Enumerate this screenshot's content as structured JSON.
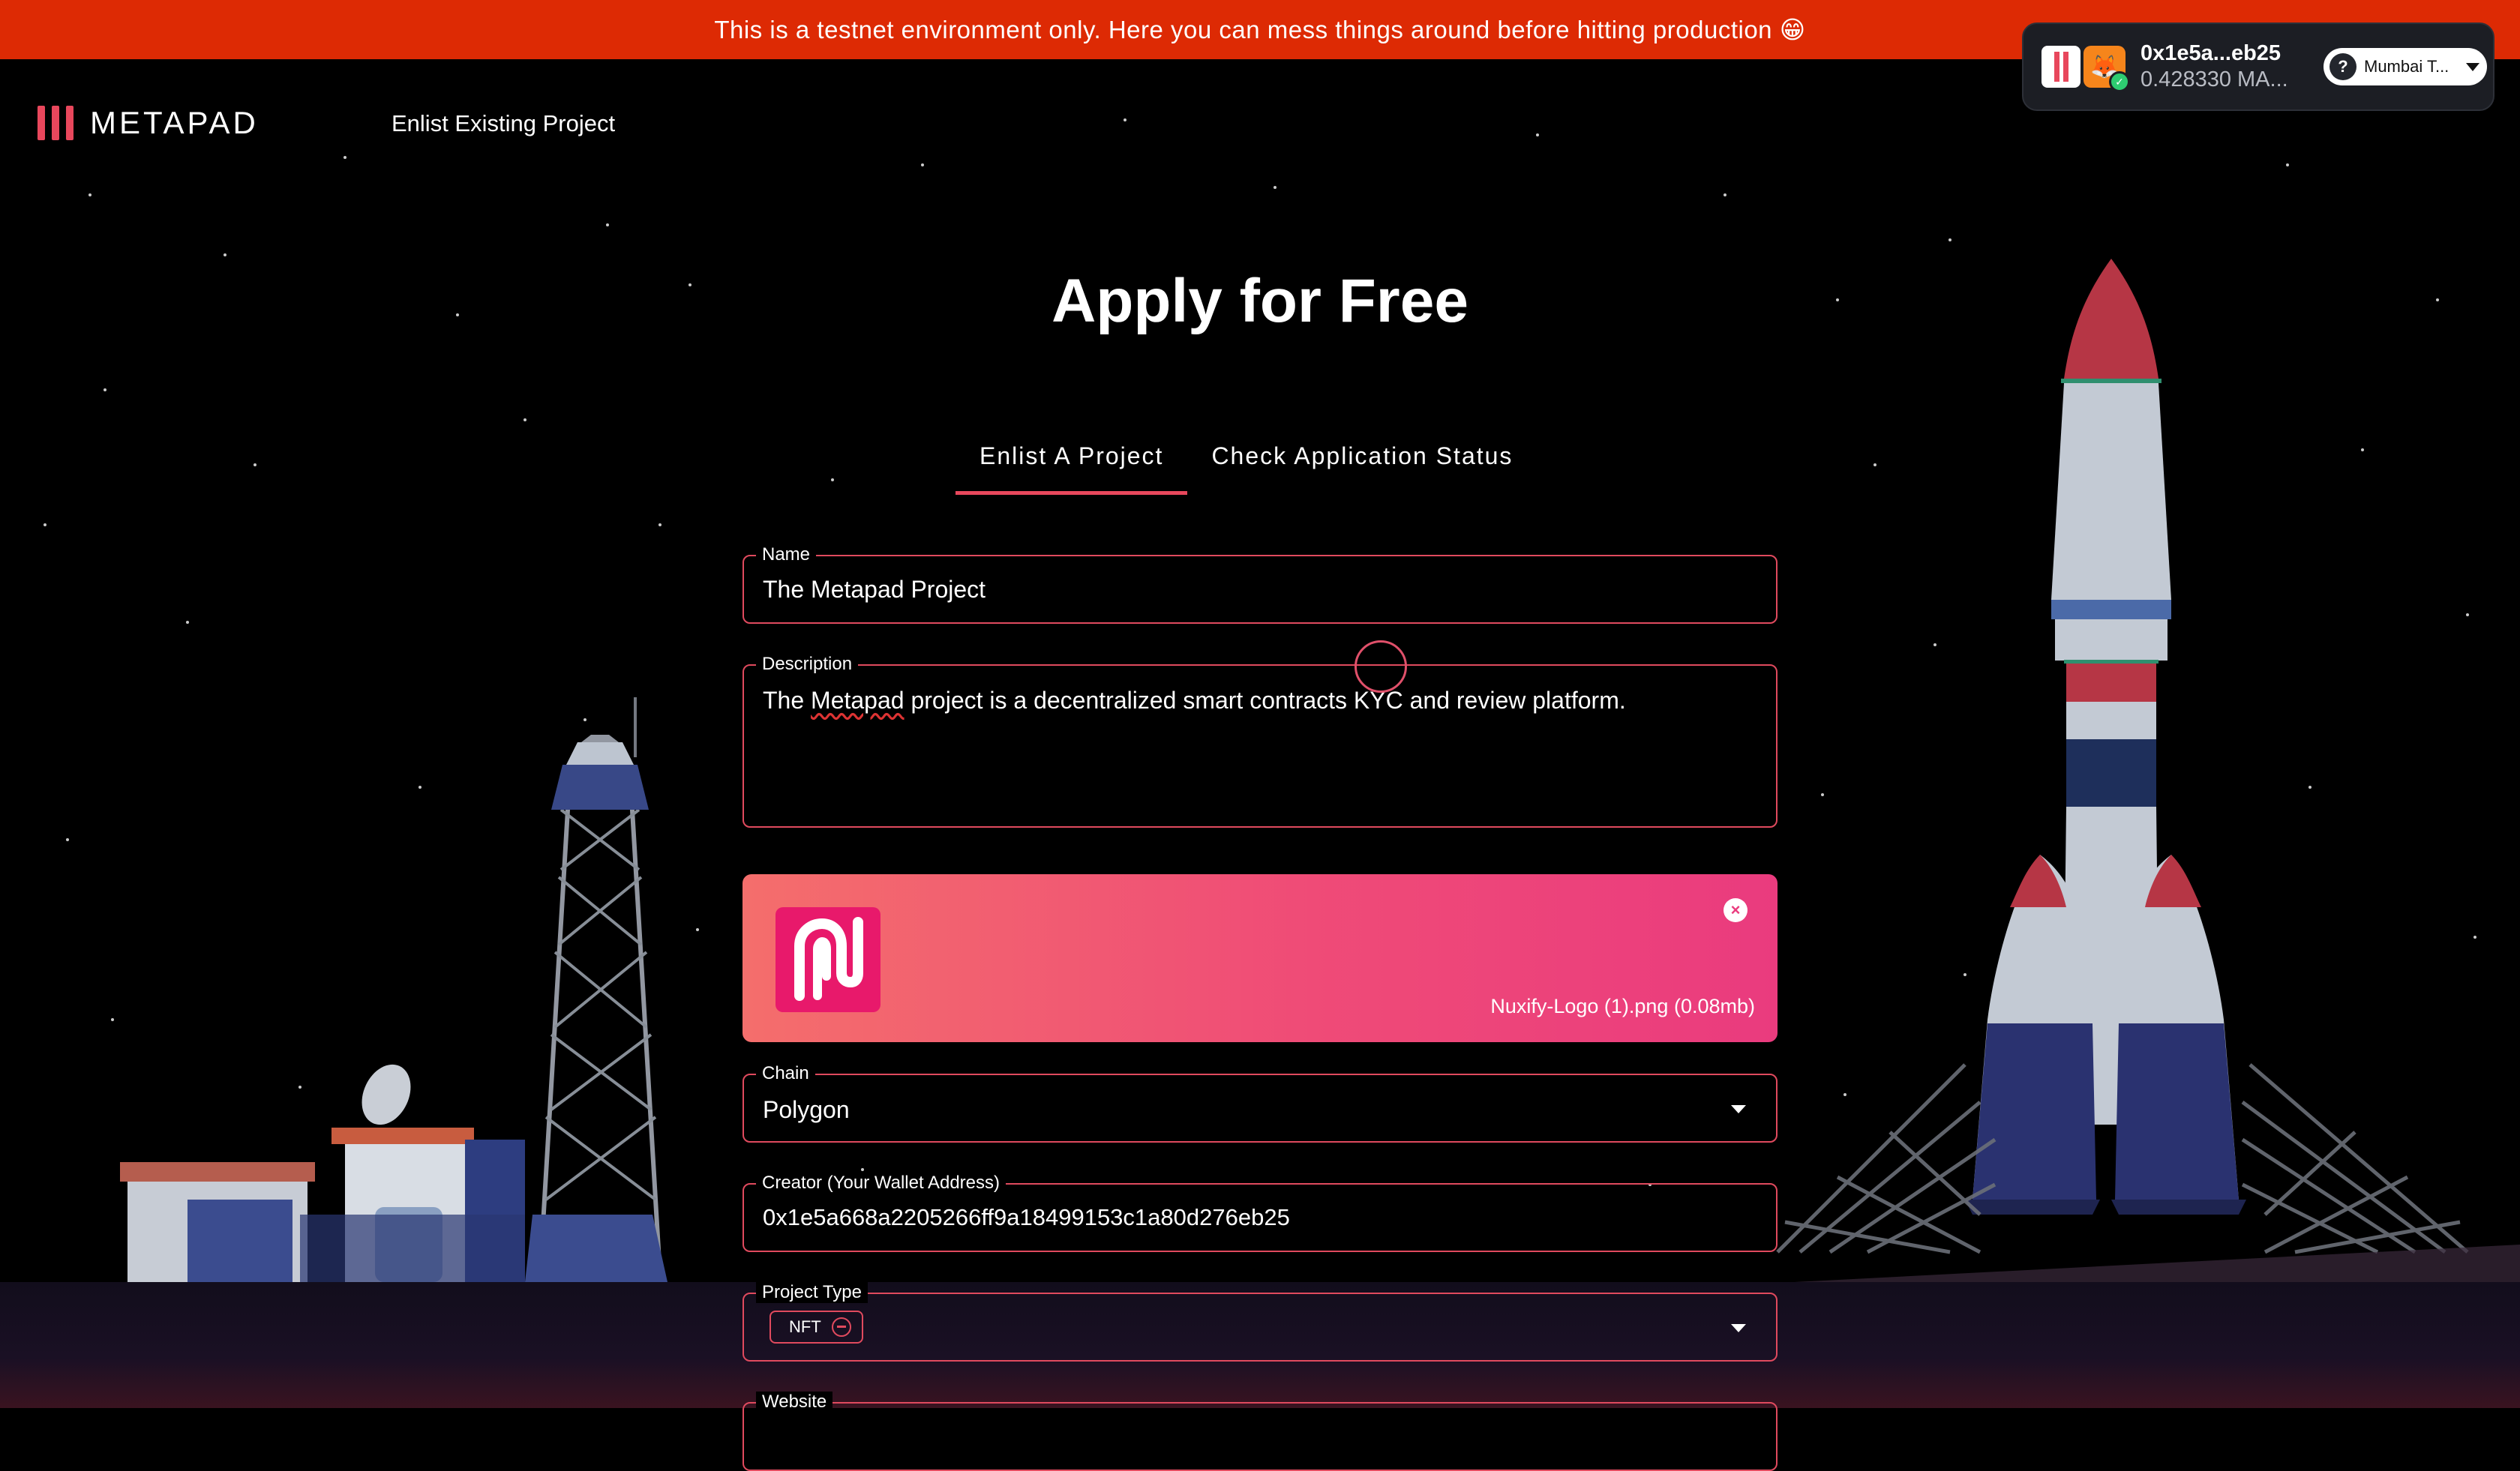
{
  "banner": {
    "text": "This is a testnet environment only. Here you can mess things around before hitting production 😁"
  },
  "header": {
    "logo_text": "METAPAD",
    "nav_link": "Enlist Existing Project"
  },
  "wallet": {
    "address": "0x1e5a...eb25",
    "balance": "0.428330 MA...",
    "network": "Mumbai T..."
  },
  "page": {
    "title": "Apply for Free",
    "tabs": [
      {
        "label": "Enlist A Project",
        "active": true
      },
      {
        "label": "Check Application Status",
        "active": false
      }
    ]
  },
  "form": {
    "name": {
      "label": "Name",
      "value": "The Metapad Project"
    },
    "description": {
      "label": "Description",
      "value_before": "The ",
      "value_misspelled": "Metapad",
      "value_after": " project is a decentralized smart contracts KYC and review platform."
    },
    "upload": {
      "file_name": "Nuxify-Logo (1).png (0.08mb)"
    },
    "chain": {
      "label": "Chain",
      "value": "Polygon"
    },
    "creator": {
      "label": "Creator (Your Wallet Address)",
      "value": "0x1e5a668a2205266ff9a18499153c1a80d276eb25"
    },
    "project_type": {
      "label": "Project Type",
      "chip": "NFT"
    },
    "website": {
      "label": "Website"
    }
  },
  "colors": {
    "banner": "#dd2a04",
    "accent": "#e8475c",
    "upload_start": "#f46e6c",
    "upload_end": "#ea3b7e"
  }
}
